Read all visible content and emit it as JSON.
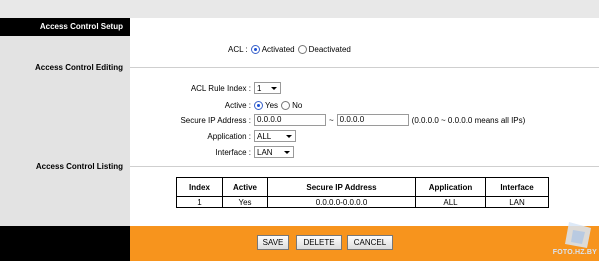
{
  "sidebar": {
    "setup": "Access Control Setup",
    "editing": "Access Control Editing",
    "listing": "Access Control Listing"
  },
  "acl": {
    "label": "ACL :",
    "options": [
      "Activated",
      "Deactivated"
    ],
    "selected": "Activated"
  },
  "editing": {
    "rule_index_label": "ACL Rule Index :",
    "rule_index_value": "1",
    "active_label": "Active :",
    "active_options": [
      "Yes",
      "No"
    ],
    "active_selected": "Yes",
    "secure_ip_label": "Secure IP Address :",
    "ip_start": "0.0.0.0",
    "ip_separator": "~",
    "ip_end": "0.0.0.0",
    "ip_hint": "(0.0.0.0 ~ 0.0.0.0 means all IPs)",
    "application_label": "Application :",
    "application_value": "ALL",
    "interface_label": "Interface :",
    "interface_value": "LAN"
  },
  "listing": {
    "headers": [
      "Index",
      "Active",
      "Secure IP Address",
      "Application",
      "Interface"
    ],
    "rows": [
      [
        "1",
        "Yes",
        "0.0.0.0-0.0.0.0",
        "ALL",
        "LAN"
      ]
    ]
  },
  "buttons": {
    "save": "SAVE",
    "delete": "DELETE",
    "cancel": "CANCEL"
  },
  "watermark": "FOTO.HZ.BY",
  "colors": {
    "accent_orange": "#f7941d",
    "dark": "#000000",
    "sidebar_gray": "#e3e3e3"
  }
}
